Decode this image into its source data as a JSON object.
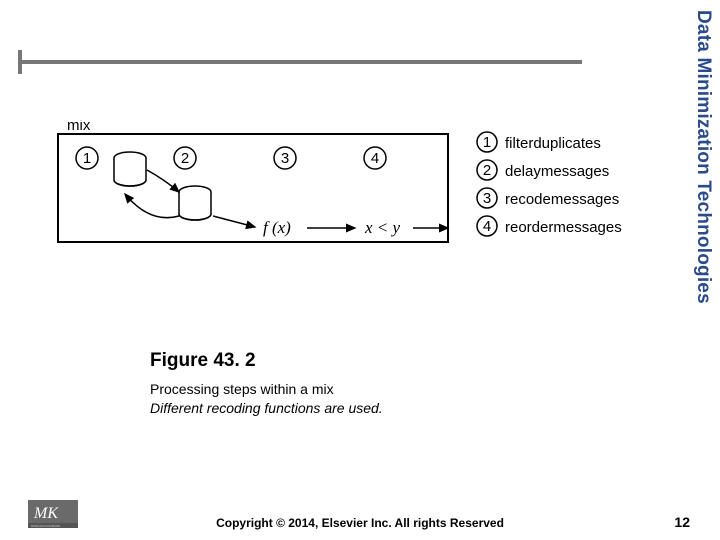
{
  "side_title": "Data Minimization Technologies",
  "figure": {
    "label": "Figure 43. 2",
    "caption_line1": "Processing steps within a mix",
    "caption_line2": "Different recoding functions are used."
  },
  "footer": {
    "copyright": "Copyright © 2014, Elsevier Inc. All rights Reserved",
    "page": "12",
    "logo_text": "MK",
    "logo_sub": "MORGAN KAUFMANN"
  },
  "diagram": {
    "box_label": "mix",
    "fx": "f (x)",
    "cmp": "x < y",
    "steps": [
      {
        "n": "1",
        "label": "filterduplicates"
      },
      {
        "n": "2",
        "label": "delaymessages"
      },
      {
        "n": "3",
        "label": "recodemessages"
      },
      {
        "n": "4",
        "label": "reordermessages"
      }
    ]
  }
}
